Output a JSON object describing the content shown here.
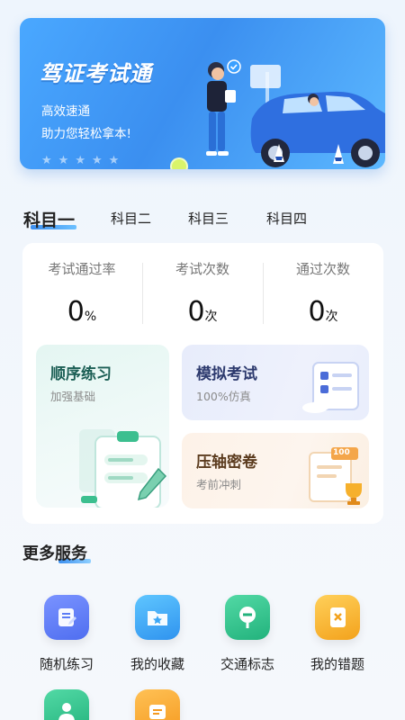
{
  "banner": {
    "title": "驾证考试通",
    "line1": "高效速通",
    "line2": "助力您轻松拿本!",
    "stars": [
      "★",
      "★",
      "★",
      "★",
      "★"
    ]
  },
  "tabs": [
    {
      "label": "科目一",
      "active": true
    },
    {
      "label": "科目二",
      "active": false
    },
    {
      "label": "科目三",
      "active": false
    },
    {
      "label": "科目四",
      "active": false
    }
  ],
  "stats": [
    {
      "label": "考试通过率",
      "value": "0",
      "unit": "%"
    },
    {
      "label": "考试次数",
      "value": "0",
      "unit": "次"
    },
    {
      "label": "通过次数",
      "value": "0",
      "unit": "次"
    }
  ],
  "tiles": {
    "order": {
      "title": "顺序练习",
      "sub": "加强基础"
    },
    "mock": {
      "title": "模拟考试",
      "sub": "100%仿真"
    },
    "exam": {
      "title": "压轴密卷",
      "sub": "考前冲刺",
      "badge": "100"
    }
  },
  "more": {
    "title": "更多服务",
    "items": [
      {
        "label": "随机练习",
        "icon": "random-practice-icon",
        "color": "#5b7cf5"
      },
      {
        "label": "我的收藏",
        "icon": "favorites-folder-icon",
        "color": "#3aa6f5"
      },
      {
        "label": "交通标志",
        "icon": "traffic-sign-icon",
        "color": "#2fc08c"
      },
      {
        "label": "我的错题",
        "icon": "wrong-questions-icon",
        "color": "#f6b02c"
      },
      {
        "label": "",
        "icon": "person-icon",
        "color": "#2fc08c"
      },
      {
        "label": "",
        "icon": "document-icon",
        "color": "#f6b02c"
      }
    ]
  }
}
